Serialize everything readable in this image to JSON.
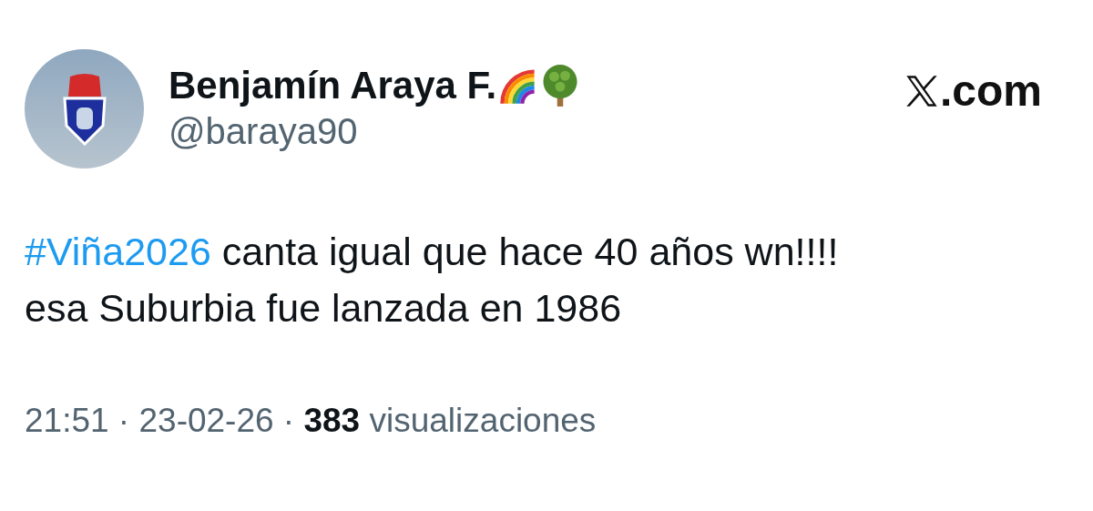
{
  "author": {
    "name": "Benjamín Araya F.",
    "handle": "@baraya90"
  },
  "brand": {
    "suffix": ".com"
  },
  "tweet": {
    "hashtag": "#Viña2026",
    "line_1": " canta igual que hace 40 años wn!!!!",
    "line_2": "esa Suburbia fue lanzada en 1986"
  },
  "meta": "21:51 · 23-02-26 · **383** visualizaciones"
}
